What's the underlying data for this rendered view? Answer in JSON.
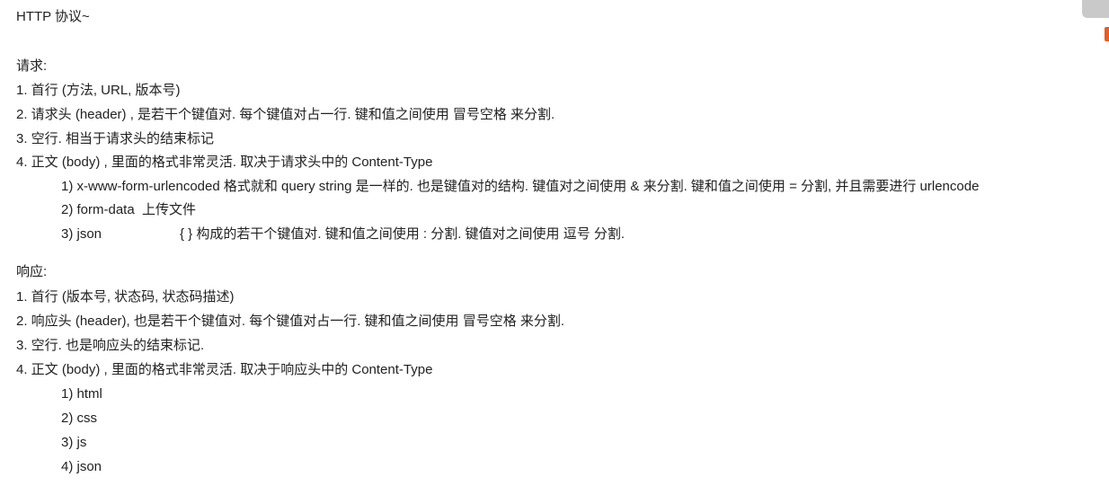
{
  "title": "HTTP 协议~",
  "request": {
    "heading": "请求:",
    "items": [
      "1. 首行 (方法, URL, 版本号)",
      "2. 请求头 (header) , 是若干个键值对. 每个键值对占一行. 键和值之间使用 冒号空格 来分割.",
      "3. 空行. 相当于请求头的结束标记",
      "4. 正文 (body) , 里面的格式非常灵活. 取决于请求头中的 Content-Type"
    ],
    "body_types": [
      {
        "label": "1) x-www-form-urlencoded 格式就和 query string 是一样的. 也是键值对的结构. 键值对之间使用 & 来分割. 键和值之间使用 = 分割, 并且需要进行 urlencode"
      },
      {
        "label": "2) form-data  上传文件"
      },
      {
        "label": "3) json",
        "desc": "{ } 构成的若干个键值对. 键和值之间使用 : 分割. 键值对之间使用 逗号 分割."
      }
    ]
  },
  "response": {
    "heading": "响应:",
    "items": [
      "1. 首行 (版本号, 状态码, 状态码描述)",
      "2. 响应头 (header), 也是若干个键值对. 每个键值对占一行. 键和值之间使用 冒号空格 来分割.",
      "3. 空行. 也是响应头的结束标记.",
      "4. 正文 (body) , 里面的格式非常灵活. 取决于响应头中的 Content-Type"
    ],
    "body_types": [
      "1) html",
      "2) css",
      "3) js",
      "4) json"
    ]
  }
}
